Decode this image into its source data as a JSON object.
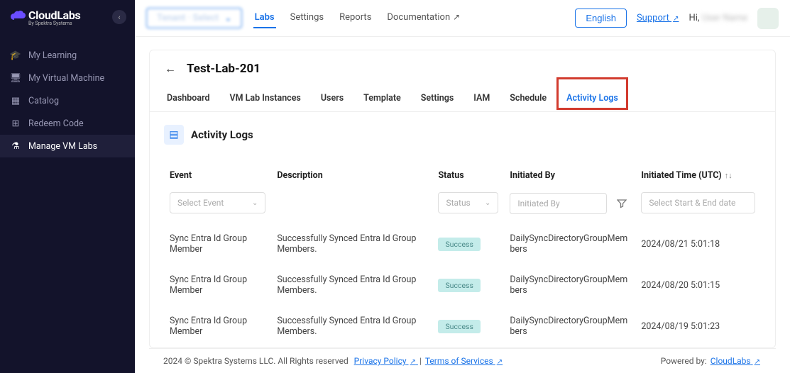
{
  "brand": {
    "name": "CloudLabs",
    "subtitle": "By Spektra Systems"
  },
  "sidebar": {
    "items": [
      {
        "label": "My Learning",
        "icon": "cap-icon"
      },
      {
        "label": "My Virtual Machine",
        "icon": "monitor-icon"
      },
      {
        "label": "Catalog",
        "icon": "grid-icon"
      },
      {
        "label": "Redeem Code",
        "icon": "ticket-icon"
      },
      {
        "label": "Manage VM Labs",
        "icon": "flask-icon"
      }
    ],
    "active_index": 4
  },
  "topbar": {
    "tenant_label": "Tenant · Select",
    "nav": [
      {
        "label": "Labs"
      },
      {
        "label": "Settings"
      },
      {
        "label": "Reports"
      },
      {
        "label": "Documentation",
        "external": true
      }
    ],
    "active_nav_index": 0,
    "language": "English",
    "support_label": "Support",
    "hi_label": "Hi,",
    "user_name": "User Name"
  },
  "page": {
    "title": "Test-Lab-201",
    "subtabs": [
      "Dashboard",
      "VM Lab Instances",
      "Users",
      "Template",
      "Settings",
      "IAM",
      "Schedule",
      "Activity Logs"
    ],
    "active_subtab_index": 7,
    "section_title": "Activity Logs",
    "columns": [
      "Event",
      "Description",
      "Status",
      "Initiated By",
      "Initiated Time (UTC)"
    ],
    "filters": {
      "event_placeholder": "Select Event",
      "status_placeholder": "Status",
      "initiated_by_placeholder": "Initiated By",
      "date_placeholder": "Select Start & End date"
    },
    "rows": [
      {
        "event": "Sync Entra Id Group Member",
        "description": "Successfully Synced Entra Id Group Members.",
        "status": "Success",
        "initiated_by": "DailySyncDirectoryGroupMembers",
        "time": "2024/08/21 5:01:18"
      },
      {
        "event": "Sync Entra Id Group Member",
        "description": "Successfully Synced Entra Id Group Members.",
        "status": "Success",
        "initiated_by": "DailySyncDirectoryGroupMembers",
        "time": "2024/08/20 5:01:15"
      },
      {
        "event": "Sync Entra Id Group Member",
        "description": "Successfully Synced Entra Id Group Members.",
        "status": "Success",
        "initiated_by": "DailySyncDirectoryGroupMembers",
        "time": "2024/08/19 5:01:23"
      }
    ]
  },
  "footer": {
    "copyright": "2024 © Spektra Systems LLC. All Rights reserved",
    "privacy": "Privacy Policy",
    "terms": "Terms of Services",
    "powered_label": "Powered by:",
    "powered_name": "CloudLabs"
  },
  "icons": {
    "cap": "🎓",
    "monitor": "🖥",
    "grid": "▦",
    "ticket": "⊞",
    "flask": "⚗",
    "chevron_left": "‹",
    "external": "↗",
    "back": "←",
    "filter": "⧩",
    "sort": "↑↓",
    "book": "▤",
    "caret": "⌄"
  }
}
